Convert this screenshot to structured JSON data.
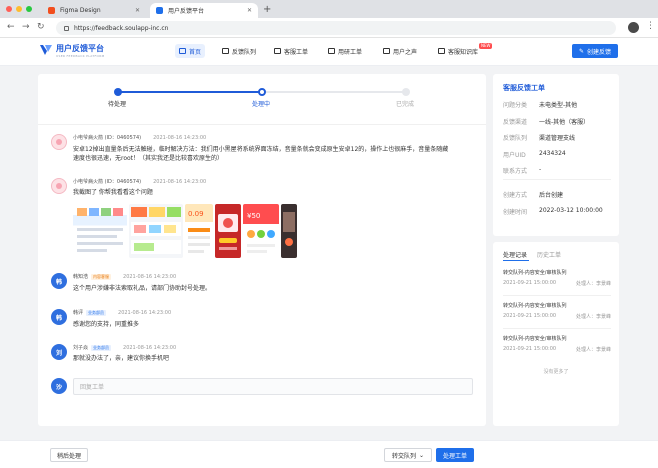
{
  "browser": {
    "tabs": [
      {
        "label": "Figma Design",
        "active": false
      },
      {
        "label": "用户反馈平台",
        "active": true
      }
    ],
    "url": "https://feedback.soulapp-inc.cn"
  },
  "header": {
    "brand": "用户反馈平台",
    "brand_sub": "USER FEEDBACK PLATFORM",
    "nav": [
      {
        "label": "首页",
        "active": true
      },
      {
        "label": "反馈队列",
        "active": false
      },
      {
        "label": "客服工单",
        "active": false
      },
      {
        "label": "用研工单",
        "active": false
      },
      {
        "label": "用户之声",
        "active": false
      },
      {
        "label": "客服知识库",
        "active": false
      }
    ],
    "new_badge": "NEW",
    "create_button": "创建反馈"
  },
  "steps": [
    {
      "label": "待处理",
      "state": "done"
    },
    {
      "label": "处理中",
      "state": "current"
    },
    {
      "label": "已完成",
      "state": "todo"
    }
  ],
  "messages": [
    {
      "author": "小电爷病火箭 (ID：0460574)",
      "time": "2021-08-16 14:23:00",
      "text1": "安卓12掉出直量条后无法触碰，临时解决方法：我们用小黑屋将系统界面冻结，音量条就会变成原生安卓12的，操作上也很麻手，音量条随藏",
      "text2": "速度也很迅速，无root！（其实我还是比较喜欢原生的）"
    },
    {
      "author": "小电爷病火箭 (ID：0460574)",
      "time": "2021-08-16 14:23:00",
      "text1": "我截图了 你帮我看看这个问题"
    },
    {
      "avatar": "韩",
      "author": "韩知浩",
      "tag": "内容客服",
      "time": "2021-08-16 14:23:00",
      "text1": "这个用户涉嫌非法索取礼品，请部门协助封号处理。"
    },
    {
      "avatar": "韩",
      "author": "韩评",
      "tag": "业务部员",
      "time": "2021-08-16 14:23:00",
      "text1": "感谢您的支持，同重推多"
    },
    {
      "avatar": "刘",
      "author": "刘子焱",
      "tag": "业务部员",
      "time": "2021-08-16 14:23:00",
      "text1": "那就没办法了，亲，建议你换手机吧"
    }
  ],
  "reply": {
    "avatar": "沙",
    "placeholder": "回复工单"
  },
  "ticket": {
    "title": "客服反馈工单",
    "rows": [
      {
        "k": "问题分类",
        "v": "未电类型-其他"
      },
      {
        "k": "反馈渠道",
        "v": "一线-其他（客服）"
      },
      {
        "k": "反馈队列",
        "v": "渠道管理支线"
      },
      {
        "k": "用户UID",
        "v": "2434324"
      },
      {
        "k": "联系方式",
        "v": "-"
      },
      {
        "k": "创建方式",
        "v": "后台创建"
      },
      {
        "k": "创建时间",
        "v": "2022-03-12 10:00:00"
      }
    ]
  },
  "records": {
    "tabs": [
      "处理记录",
      "历史工单"
    ],
    "items": [
      {
        "title": "转交队列-内容安全/审核队列",
        "time": "2021-09-21 15:00:00",
        "handler": "处理人：李景峰"
      },
      {
        "title": "转交队列-内容安全/审核队列",
        "time": "2021-09-21 15:00:00",
        "handler": "处理人：李景峰"
      },
      {
        "title": "转交队列-内容安全/审核队列",
        "time": "2021-09-21 15:00:00",
        "handler": "处理人：李景峰"
      }
    ],
    "no_more": "没有更多了"
  },
  "actions": {
    "later": "稍后处理",
    "transfer": "转交队列",
    "process": "处理工单"
  }
}
